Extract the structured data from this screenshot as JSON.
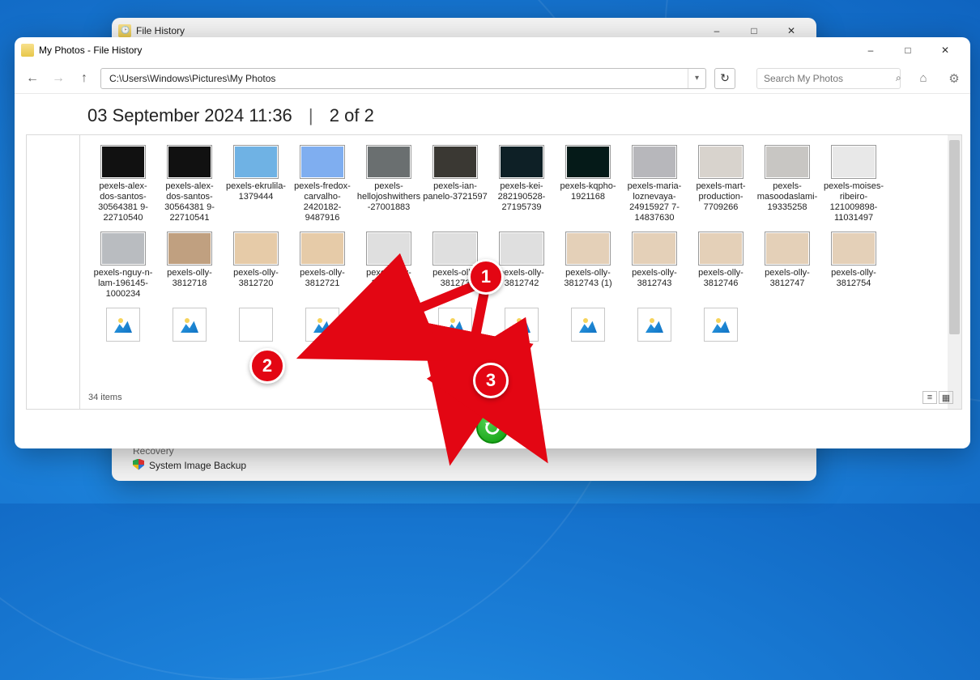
{
  "backWindow": {
    "title": "File History",
    "sidebar": {
      "recovery": "Recovery",
      "systemImage": "System Image Backup"
    }
  },
  "frontWindow": {
    "title": "My Photos - File History",
    "address": "C:\\Users\\Windows\\Pictures\\My Photos",
    "searchPlaceholder": "Search My Photos",
    "timestamp": "03 September 2024 11:36",
    "pageInfo": "2 of 2",
    "status": "34 items"
  },
  "files": {
    "row1": [
      {
        "name": "pexels-alex-dos-santos-30564381\n9-22710540",
        "c": 0
      },
      {
        "name": "pexels-alex-dos-santos-30564381\n9-22710541",
        "c": 1
      },
      {
        "name": "pexels-ekrulila-1379444",
        "c": 2
      },
      {
        "name": "pexels-fredox-carvalho-2420182-9487916",
        "c": 3
      },
      {
        "name": "pexels-hellojoshwithers-27001883",
        "c": 4
      },
      {
        "name": "pexels-ian-panelo-3721597",
        "c": 5
      },
      {
        "name": "pexels-kei-282190528-27195739",
        "c": 6
      },
      {
        "name": "pexels-kqpho-1921168",
        "c": 7
      },
      {
        "name": "pexels-maria-loznevaya-24915927\n7-14837630",
        "c": 8
      },
      {
        "name": "pexels-mart-production-7709266",
        "c": 9
      },
      {
        "name": "pexels-masoodaslami-19335258",
        "c": 10
      },
      {
        "name": "pexels-moises-ribeiro-121009898-11031497",
        "c": 11
      }
    ],
    "row2": [
      {
        "name": "pexels-nguy-n-lam-196145-1000234",
        "c": 12
      },
      {
        "name": "pexels-olly-3812718",
        "c": 13
      },
      {
        "name": "pexels-olly-3812720",
        "c": 14
      },
      {
        "name": "pexels-olly-3812721",
        "c": 15
      },
      {
        "name": "pexels-olly-3812731",
        "c": 16
      },
      {
        "name": "pexels-olly-381273",
        "c": 17,
        "blank": false
      },
      {
        "name": "pexels-olly-3812742",
        "c": 18,
        "blank": false
      },
      {
        "name": "pexels-olly-3812743 (1)",
        "c": 19
      },
      {
        "name": "pexels-olly-3812743",
        "c": 20
      },
      {
        "name": "pexels-olly-3812746",
        "c": 21
      },
      {
        "name": "pexels-olly-3812747",
        "c": 22
      },
      {
        "name": "pexels-olly-3812754",
        "c": 23
      }
    ]
  },
  "annotations": {
    "n1": "1",
    "n2": "2",
    "n3": "3"
  }
}
